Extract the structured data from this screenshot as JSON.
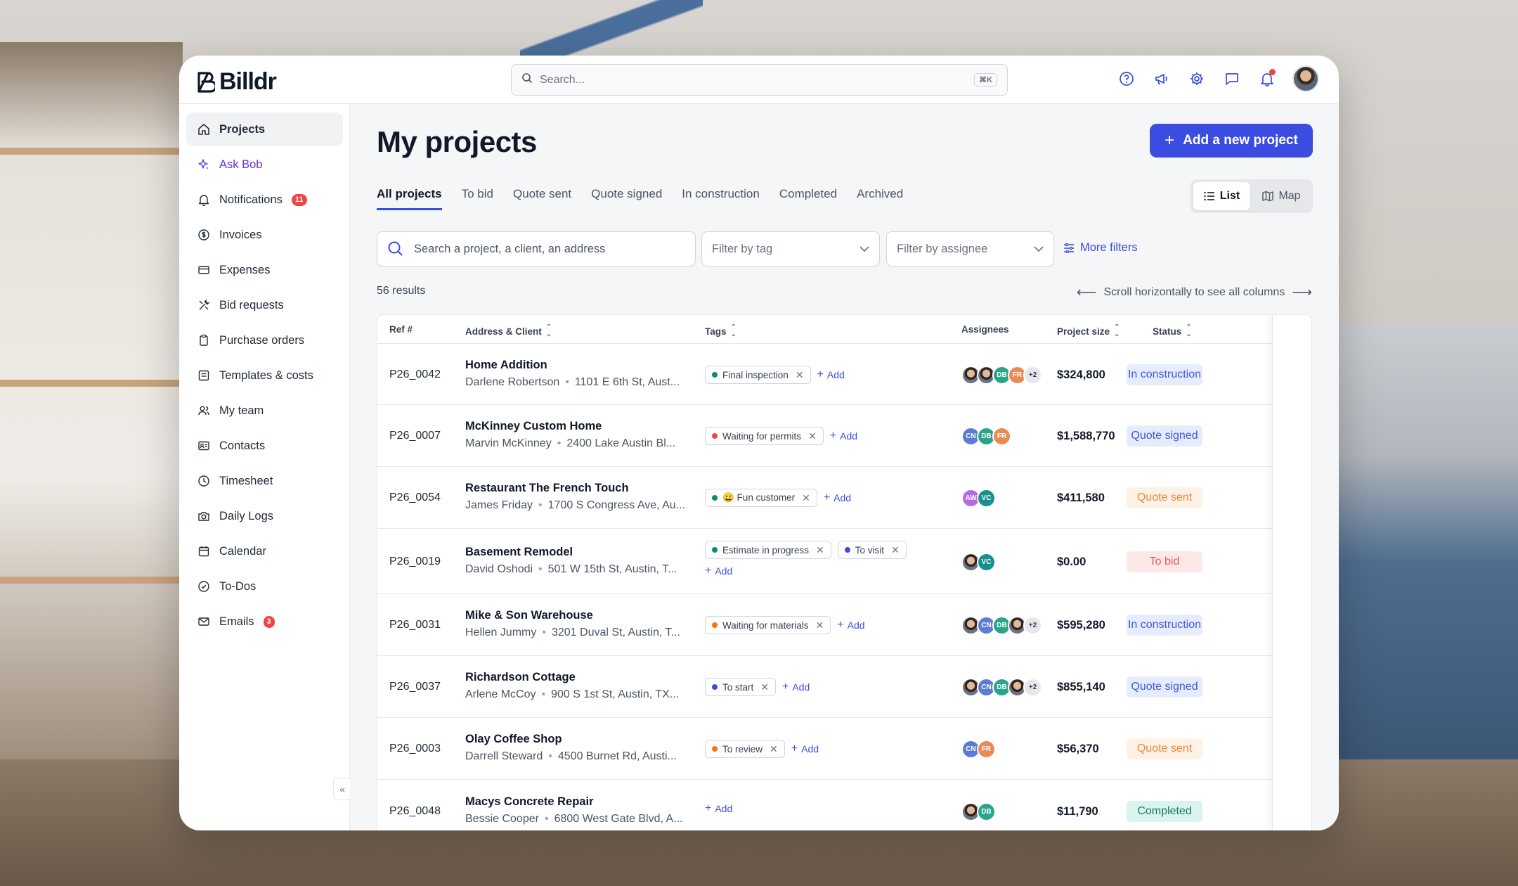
{
  "app": {
    "brand": "Billdr"
  },
  "topbar": {
    "search_placeholder": "Search...",
    "search_shortcut": "⌘K",
    "icons": [
      "help-circle-icon",
      "megaphone-icon",
      "gear-icon",
      "chat-icon",
      "bell-icon",
      "user-avatar"
    ]
  },
  "sidebar": {
    "items": [
      {
        "label": "Projects",
        "icon": "home-icon"
      },
      {
        "label": "Ask Bob",
        "icon": "sparkles-icon"
      },
      {
        "label": "Notifications",
        "icon": "bell-icon",
        "badge": "11"
      },
      {
        "label": "Invoices",
        "icon": "dollar-icon"
      },
      {
        "label": "Expenses",
        "icon": "card-icon"
      },
      {
        "label": "Bid requests",
        "icon": "tools-icon"
      },
      {
        "label": "Purchase orders",
        "icon": "clipboard-icon"
      },
      {
        "label": "Templates & costs",
        "icon": "template-icon"
      },
      {
        "label": "My team",
        "icon": "team-icon"
      },
      {
        "label": "Contacts",
        "icon": "contacts-icon"
      },
      {
        "label": "Timesheet",
        "icon": "clock-icon"
      },
      {
        "label": "Daily Logs",
        "icon": "camera-icon"
      },
      {
        "label": "Calendar",
        "icon": "calendar-icon"
      },
      {
        "label": "To-Dos",
        "icon": "check-circle-icon"
      },
      {
        "label": "Emails",
        "icon": "mail-icon",
        "badge": "3"
      }
    ],
    "collapse_label": "«"
  },
  "main": {
    "title": "My projects",
    "add_button": "Add a new project",
    "tabs": [
      "All projects",
      "To bid",
      "Quote sent",
      "Quote signed",
      "In construction",
      "Completed",
      "Archived"
    ],
    "active_tab": "All projects",
    "view": {
      "list": "List",
      "map": "Map",
      "active": "List"
    },
    "search_placeholder": "Search a project, a client, an address",
    "filter_tag": "Filter by tag",
    "filter_assignee": "Filter by assignee",
    "more_filters": "More filters",
    "results": "56 results",
    "scroll_hint": "Scroll horizontally to see all columns"
  },
  "table": {
    "columns": [
      "Ref #",
      "Address & Client",
      "Tags",
      "Assignees",
      "Project size",
      "Status"
    ],
    "add_tag_label": "Add",
    "rows": [
      {
        "ref": "P26_0042",
        "title": "Home Addition",
        "client": "Darlene Robertson",
        "address": "1101 E 6th St, Aust...",
        "tags": [
          {
            "label": "Final inspection",
            "color": "#0f8a6e"
          }
        ],
        "assignees": [
          "photo",
          "photo",
          "DB",
          "FR",
          "+2"
        ],
        "size": "$324,800",
        "status": "In construction"
      },
      {
        "ref": "P26_0007",
        "title": "McKinney Custom Home",
        "client": "Marvin McKinney",
        "address": "2400 Lake Austin Bl...",
        "tags": [
          {
            "label": "Waiting for permits",
            "color": "#ef4444"
          }
        ],
        "assignees": [
          "CN",
          "DB",
          "FR"
        ],
        "size": "$1,588,770",
        "status": "Quote signed"
      },
      {
        "ref": "P26_0054",
        "title": "Restaurant The French Touch",
        "client": "James Friday",
        "address": "1700 S Congress Ave, Au...",
        "tags": [
          {
            "label": "😀 Fun customer",
            "color": "#0f8a6e"
          }
        ],
        "assignees": [
          "AW",
          "VC"
        ],
        "size": "$411,580",
        "status": "Quote sent"
      },
      {
        "ref": "P26_0019",
        "title": "Basement Remodel",
        "client": "David Oshodi",
        "address": "501 W 15th St, Austin, T...",
        "tags": [
          {
            "label": "Estimate in progress",
            "color": "#0f8a6e"
          },
          {
            "label": "To visit",
            "color": "#3b4ce0"
          }
        ],
        "assignees": [
          "photo",
          "VC"
        ],
        "size": "$0.00",
        "status": "To bid"
      },
      {
        "ref": "P26_0031",
        "title": "Mike & Son Warehouse",
        "client": "Hellen Jummy",
        "address": "3201 Duval St, Austin, T...",
        "tags": [
          {
            "label": "Waiting for materials",
            "color": "#f97316"
          }
        ],
        "assignees": [
          "photo",
          "CN",
          "DB",
          "photo",
          "+2"
        ],
        "size": "$595,280",
        "status": "In construction"
      },
      {
        "ref": "P26_0037",
        "title": "Richardson Cottage",
        "client": "Arlene McCoy",
        "address": "900 S 1st St, Austin, TX...",
        "tags": [
          {
            "label": "To start",
            "color": "#3b4ce0"
          }
        ],
        "assignees": [
          "photo",
          "CN",
          "DB",
          "photo",
          "+2"
        ],
        "size": "$855,140",
        "status": "Quote signed"
      },
      {
        "ref": "P26_0003",
        "title": "Olay Coffee Shop",
        "client": "Darrell Steward",
        "address": "4500 Burnet Rd, Austi...",
        "tags": [
          {
            "label": "To review",
            "color": "#f97316"
          }
        ],
        "assignees": [
          "CN",
          "FR"
        ],
        "size": "$56,370",
        "status": "Quote sent"
      },
      {
        "ref": "P26_0048",
        "title": "Macys Concrete Repair",
        "client": "Bessie Cooper",
        "address": "6800 West Gate Blvd, A...",
        "tags": [],
        "assignees": [
          "photo",
          "DB"
        ],
        "size": "$11,790",
        "status": "Completed"
      }
    ]
  },
  "colors": {
    "accent": "#3b4ce0",
    "status": {
      "In construction": {
        "bg": "#e6ecfd",
        "fg": "#3b5bdb"
      },
      "Quote signed": {
        "bg": "#e6ecfd",
        "fg": "#3b5bdb"
      },
      "Quote sent": {
        "bg": "#fef1e6",
        "fg": "#ea8a3b"
      },
      "To bid": {
        "bg": "#fde8e8",
        "fg": "#e05a5a"
      },
      "Completed": {
        "bg": "#d9f3ed",
        "fg": "#167a63"
      }
    },
    "avatars": {
      "CN": "#5b7bd5",
      "DB": "#2aa58b",
      "FR": "#e98a57",
      "AW": "#b36be0",
      "VC": "#1a8f8f"
    }
  }
}
